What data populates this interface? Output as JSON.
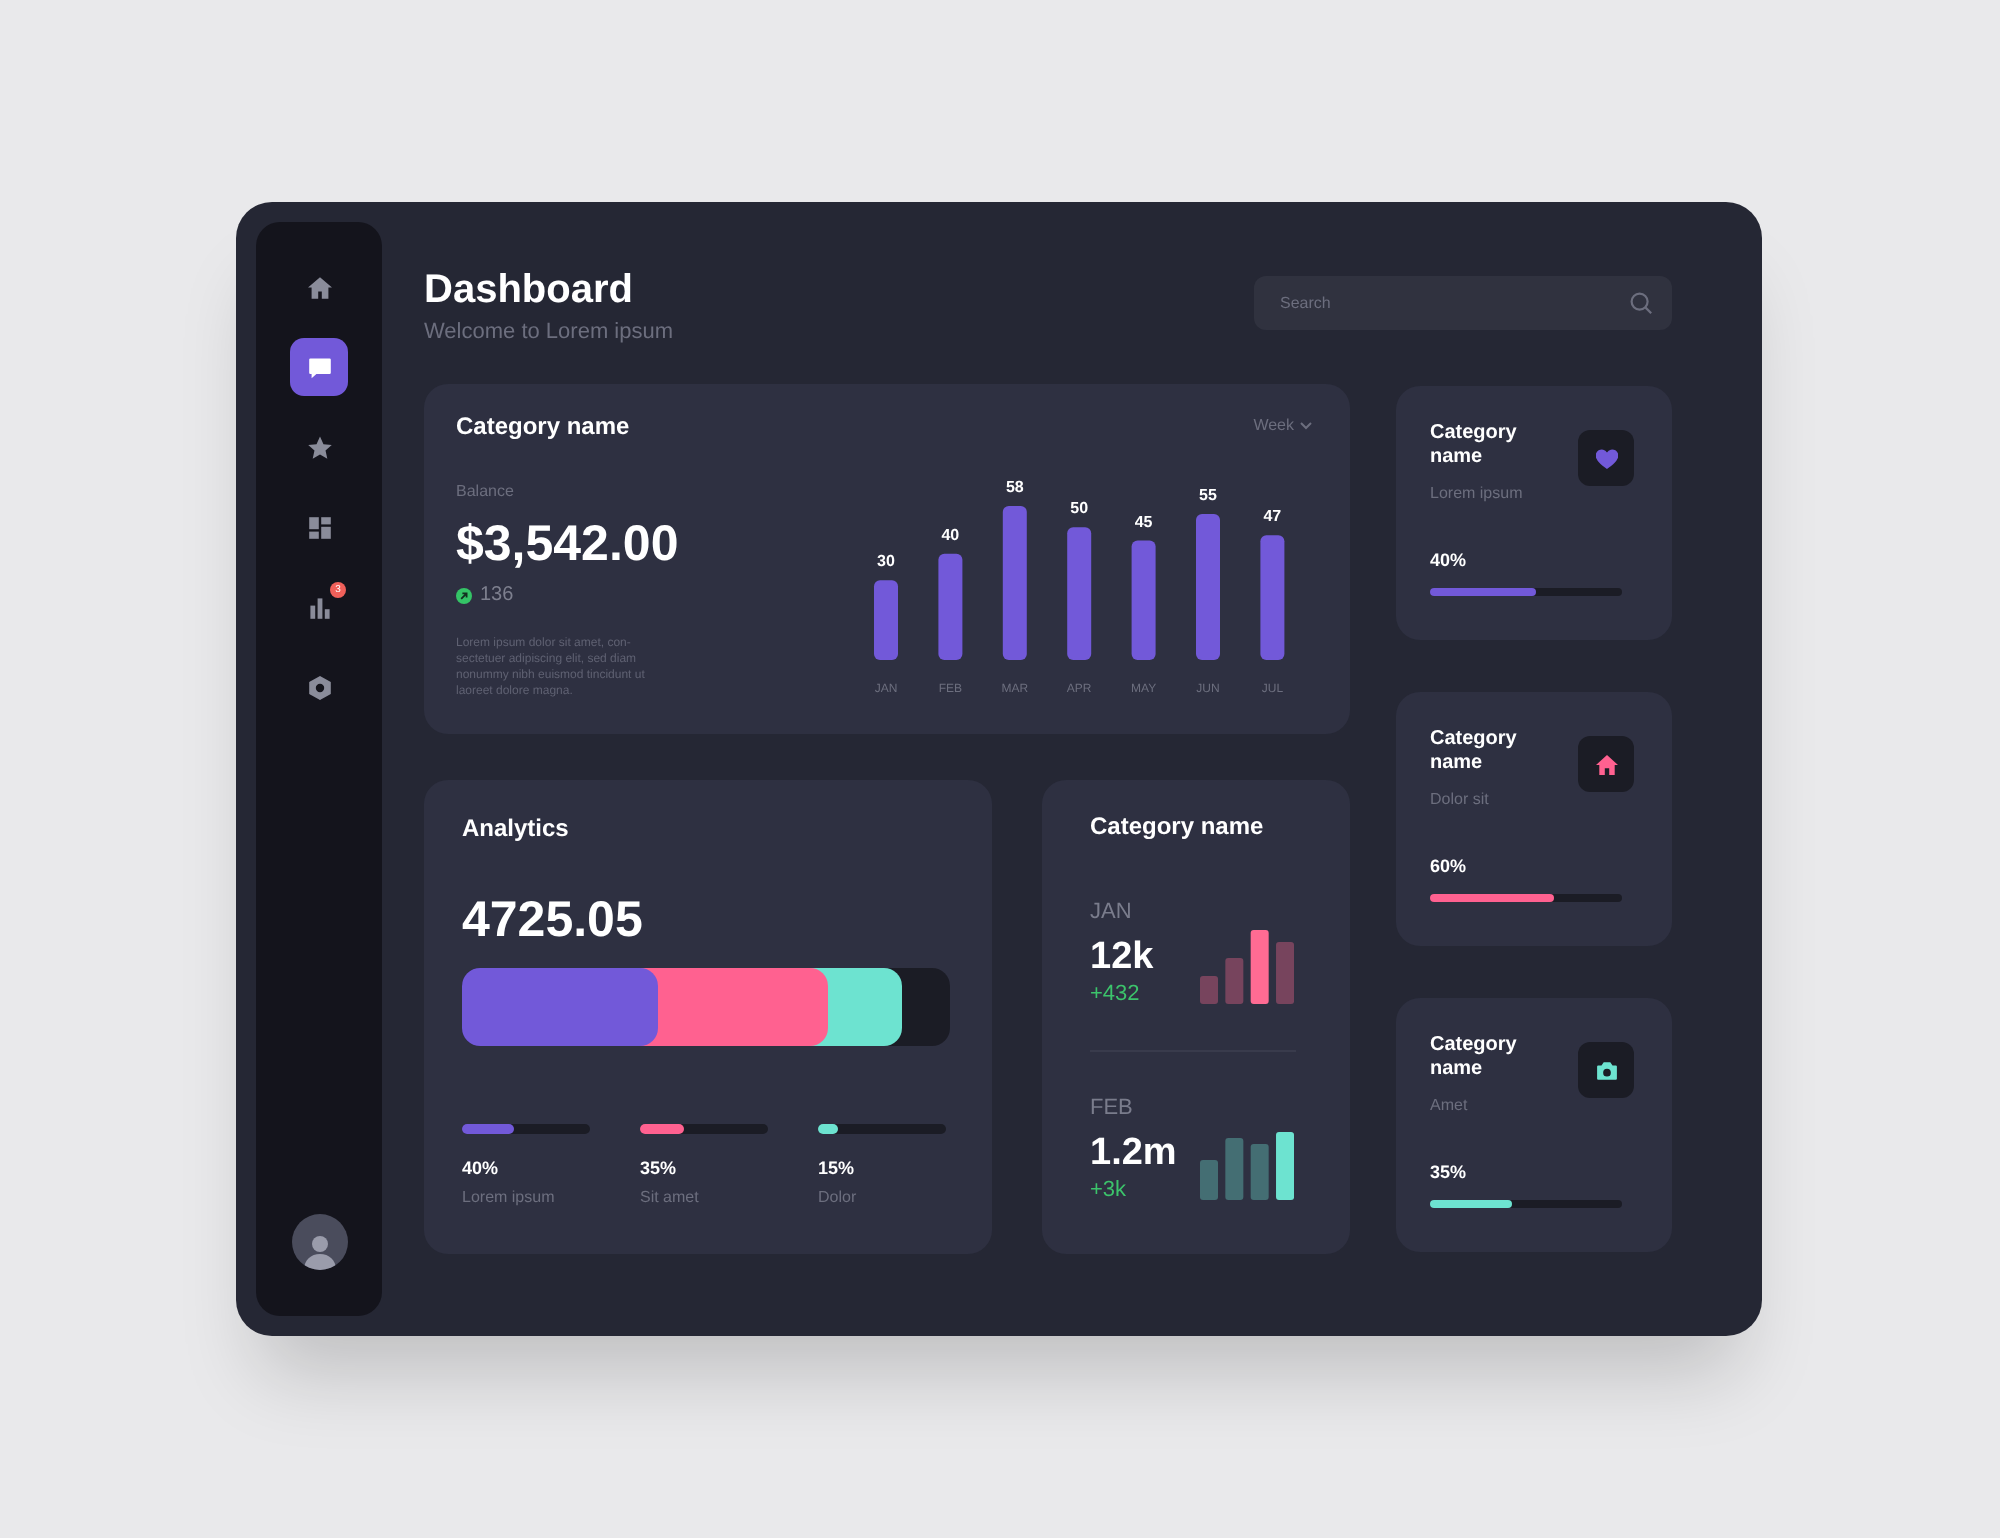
{
  "sidebar": {
    "items": [
      {
        "selected": false
      },
      {
        "selected": true
      },
      {
        "selected": false
      },
      {
        "selected": false
      },
      {
        "selected": false,
        "badge": "3"
      },
      {
        "selected": false
      }
    ]
  },
  "header": {
    "title": "Dashboard",
    "subtitle": "Welcome to Lorem ipsum"
  },
  "search": {
    "placeholder": "Search"
  },
  "balance_card": {
    "title": "Category name",
    "period": "Week",
    "label": "Balance",
    "amount": "$3,542.00",
    "change": "136",
    "description": "Lorem ipsum dolor sit amet, con-sectetuer adipiscing elit, sed diam nonummy nibh euismod tincidunt ut laoreet dolore magna.",
    "chart_data": {
      "type": "bar",
      "categories": [
        "JAN",
        "FEB",
        "MAR",
        "APR",
        "MAY",
        "JUN",
        "JUL"
      ],
      "values": [
        30,
        40,
        58,
        50,
        45,
        55,
        47
      ],
      "data_labels": true
    }
  },
  "analytics": {
    "title": "Analytics",
    "total": "4725.05",
    "segments": [
      {
        "percent": "40%",
        "label": "Lorem ipsum",
        "level": 0.4,
        "color": "#7259d9"
      },
      {
        "percent": "35%",
        "label": "Sit amet",
        "level": 0.35,
        "color": "#ff6190"
      },
      {
        "percent": "15%",
        "label": "Dolor",
        "level": 0.15,
        "color": "#6de3d0"
      }
    ]
  },
  "monthly_card": {
    "title": "Category name",
    "stats": [
      {
        "month": "JAN",
        "value": "12k",
        "delta": "+432",
        "color": "#ff6b93"
      },
      {
        "month": "FEB",
        "value": "1.2m",
        "delta": "+3k",
        "color": "#6de3d0"
      }
    ]
  },
  "category_cards": [
    {
      "title": "Category name",
      "subtitle": "Lorem ipsum",
      "percent": "40%",
      "level": 0.55,
      "color": "#7259d9"
    },
    {
      "title": "Category name",
      "subtitle": "Dolor sit",
      "percent": "60%",
      "level": 0.65,
      "color": "#ff6190"
    },
    {
      "title": "Category name",
      "subtitle": "Amet",
      "percent": "35%",
      "level": 0.43,
      "color": "#6de3d0"
    }
  ]
}
